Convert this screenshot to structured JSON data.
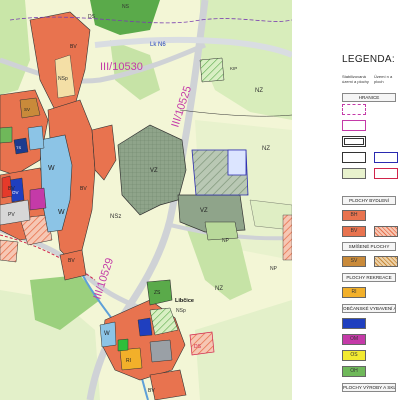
{
  "map": {
    "roads": {
      "road_10530": "III/10530",
      "road_10525": "III/10525",
      "road_10529": "III/10529",
      "lk_n6": "Lk N6"
    },
    "places": {
      "libcice": "Libčice"
    },
    "area_codes": {
      "bv": "BV",
      "w": "W",
      "vz": "VZ",
      "nz": "NZ",
      "nsp": "NSp",
      "np": "NP",
      "nsz": "NSz",
      "ds": "DS",
      "zs": "ZS",
      "rl": "RI",
      "ov": "OV",
      "pv": "PV",
      "ts": "TS",
      "sv": "SV",
      "ns": "NS",
      "dsr": "DS",
      "kip": "KIP"
    }
  },
  "legend": {
    "title": "LEGENDA:",
    "col_a": "Stabilizovaná území a plochy",
    "col_b": "Území n a ploch",
    "sections": {
      "hranice": "HRANICE",
      "bydleni": "PLOCHY BYDLENÍ",
      "smisene": "SMÍŠENÉ PLOCHY",
      "rekreace": "PLOCHY REKREACE",
      "obcanske": "OBČANSKÉ VYBAVENÍ A",
      "vyroby": "PLOCHY VÝROBY A SKLAD"
    },
    "swatches": {
      "bh": "BH",
      "bv": "BV",
      "sv": "SV",
      "ri": "RI",
      "ov": "OV",
      "om": "OM",
      "os": "OS",
      "oh": "OH"
    },
    "colors": {
      "bv": "#e8734f",
      "w": "#8cc4e6",
      "vz": "#8fa48a",
      "nz": "#f2f5d5",
      "nl": "#5aaa4a",
      "green_light": "#c9e6a8",
      "road": "#cfd2d6",
      "ov": "#1f3fbf",
      "om": "#c43aa8",
      "os": "#f2ea30",
      "oh": "#6fb85a",
      "ri": "#f2b02a",
      "sv": "#c98a3a"
    }
  }
}
